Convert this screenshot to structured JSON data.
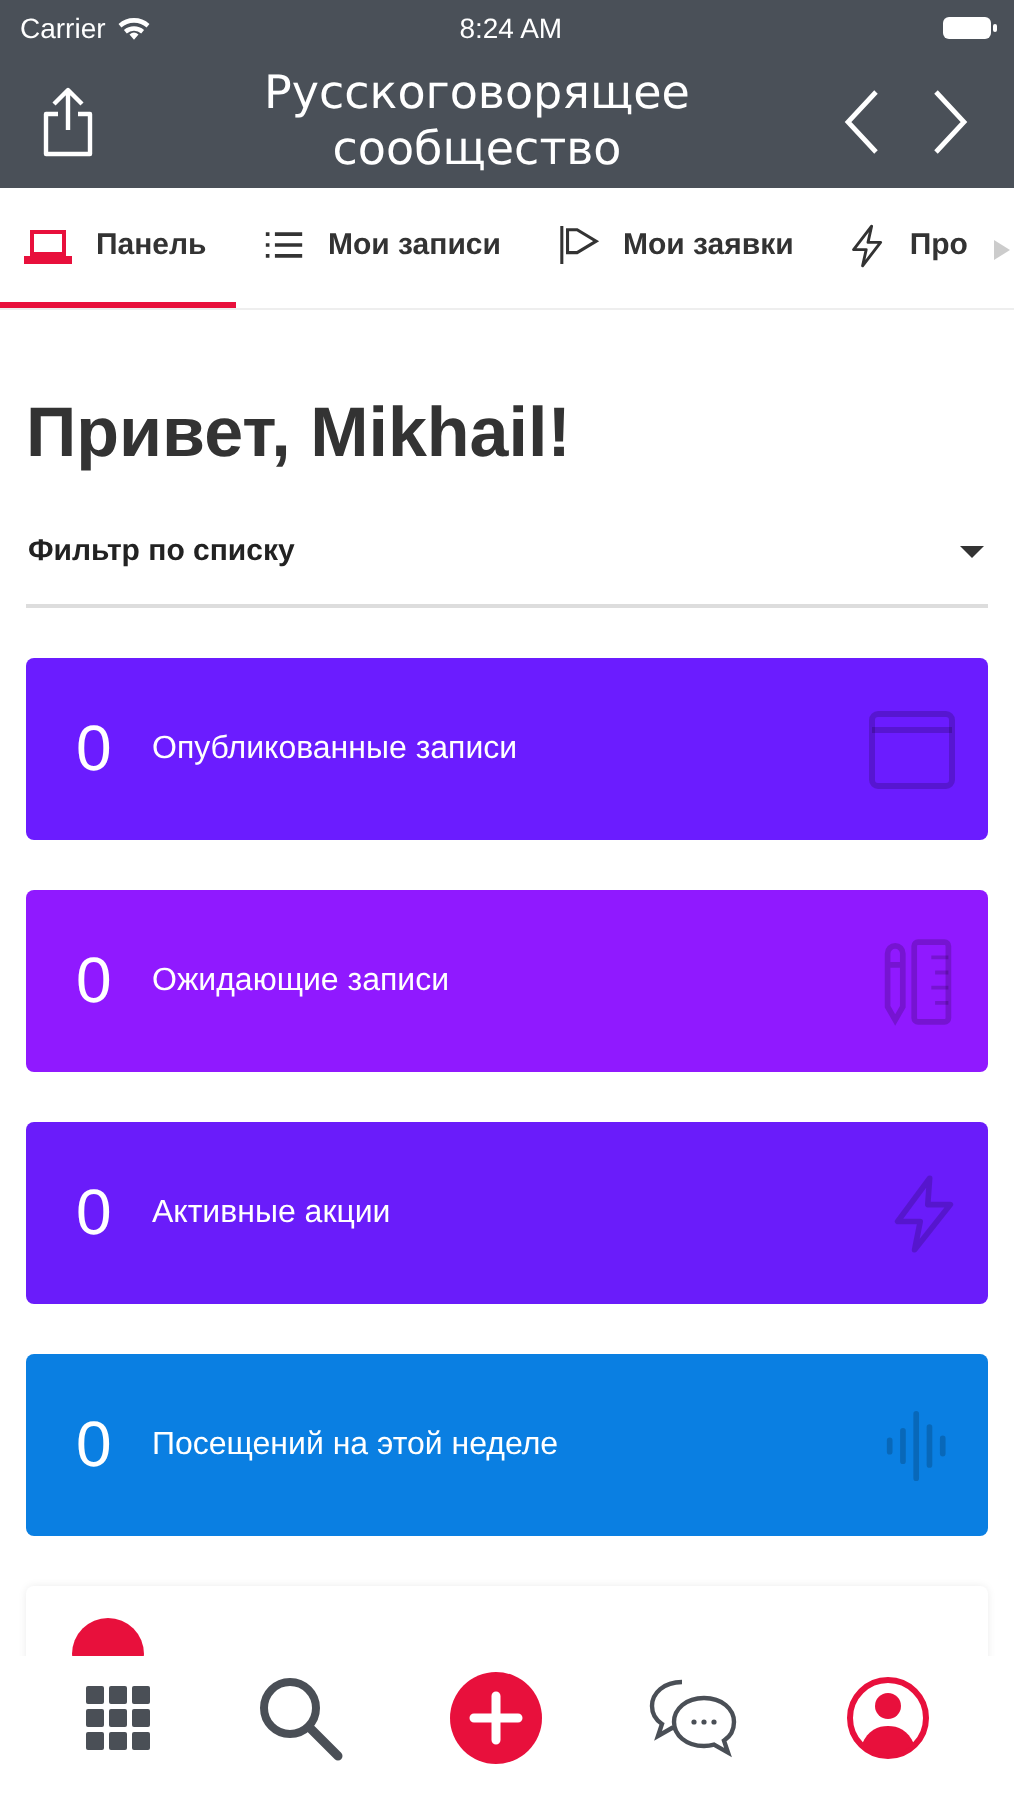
{
  "status_bar": {
    "carrier": "Carrier",
    "time": "8:24 AM"
  },
  "nav_bar": {
    "title": "Русскоговорящее сообщество"
  },
  "tabs": [
    {
      "label": "Панель",
      "kind": "laptop",
      "selected": true
    },
    {
      "label": "Мои записи",
      "kind": "list",
      "selected": false
    },
    {
      "label": "Мои заявки",
      "kind": "flag",
      "selected": false
    },
    {
      "label": "Про",
      "kind": "bolt",
      "selected": false
    }
  ],
  "greeting": "Привет, Mikhail!",
  "filter": {
    "label": "Фильтр по списку"
  },
  "stats": [
    {
      "count": "0",
      "label": "Опубликованные записи",
      "kind": "window",
      "color": "#6b1cff"
    },
    {
      "count": "0",
      "label": "Ожидающие записи",
      "kind": "tools",
      "color": "#9019ff"
    },
    {
      "count": "0",
      "label": "Активные акции",
      "kind": "bolt",
      "color": "#6a1cfa"
    },
    {
      "count": "0",
      "label": "Посещений на этой неделе",
      "kind": "wave",
      "color": "#0a7fe2"
    }
  ],
  "bottom_tabs": [
    {
      "kind": "grid"
    },
    {
      "kind": "search"
    },
    {
      "kind": "add"
    },
    {
      "kind": "chat"
    },
    {
      "kind": "profile"
    }
  ]
}
